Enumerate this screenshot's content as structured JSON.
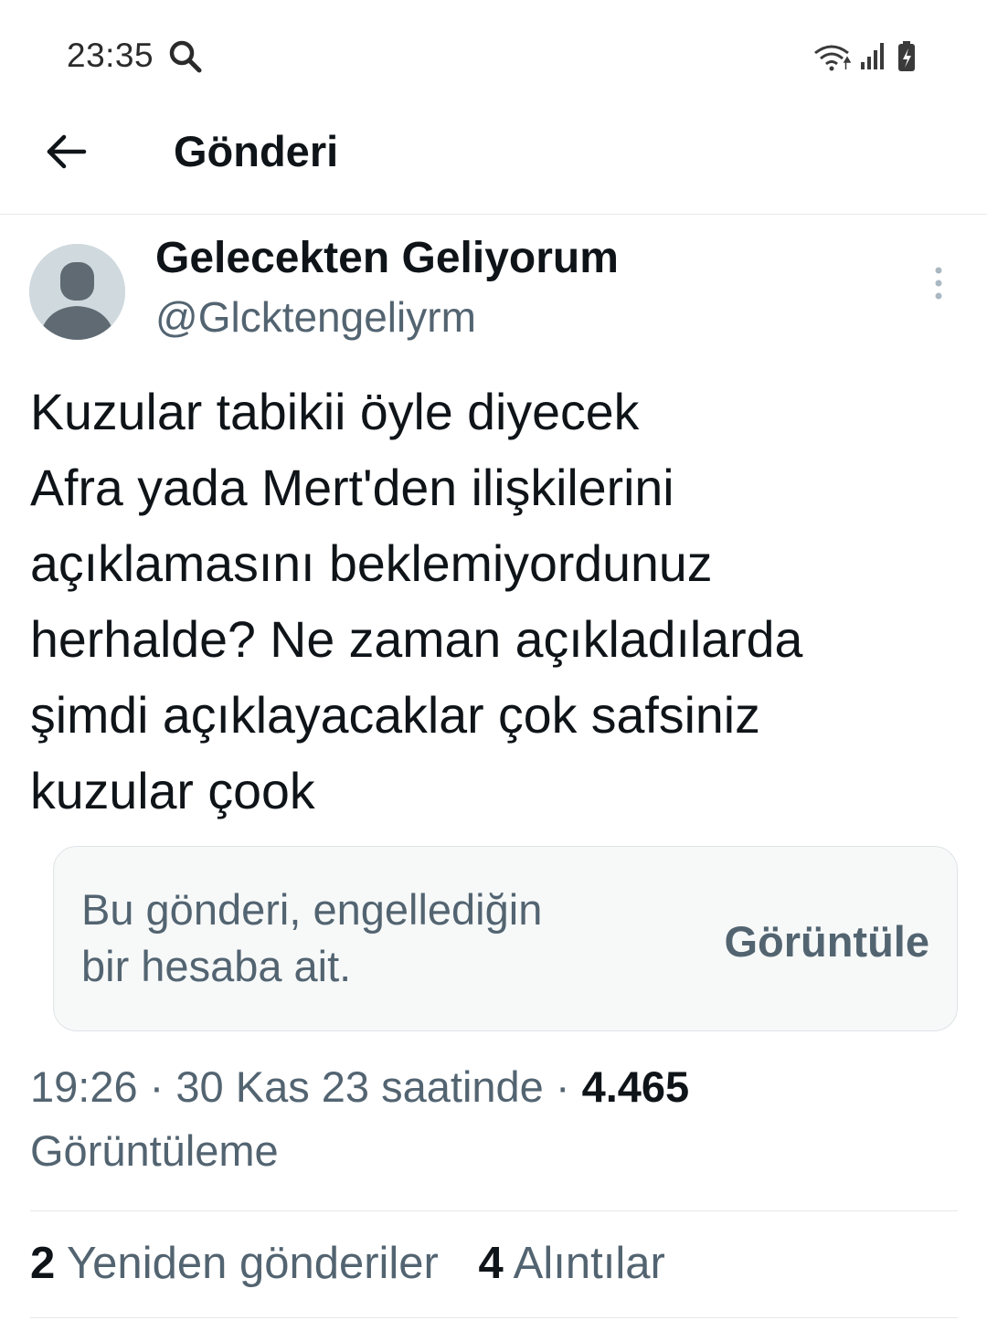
{
  "status_bar": {
    "time": "23:35",
    "icons": [
      "search-icon",
      "wifi-icon",
      "signal-icon",
      "battery-charging-icon"
    ]
  },
  "header": {
    "back_icon": "arrow-left-icon",
    "title": "Gönderi"
  },
  "tweet": {
    "author": {
      "name": "Gelecekten Geliyorum",
      "handle": "@Glcktengeliyrm",
      "avatar": "default-avatar-icon"
    },
    "more_icon": "more-vertical-icon",
    "text_lines": [
      "Kuzular tabikii öyle diyecek",
      "Afra yada Mert'den ilişkilerini",
      "açıklamasını beklemiyordunuz",
      "herhalde? Ne zaman açıkladılarda",
      "şimdi açıklayacaklar çok safsiniz",
      "kuzular çook"
    ],
    "quoted_blocked": {
      "message_lines": [
        "Bu gönderi, engellediğin",
        "bir hesaba ait."
      ],
      "action": "Görüntüle"
    },
    "timestamp": "19:26 · 30 Kas 23 saatinde · ",
    "views_count": "4.465",
    "views_label": "Görüntüleme",
    "stats": {
      "reposts_count": "2",
      "reposts_label": "Yeniden gönderiler",
      "quotes_count": "4",
      "quotes_label": "Alıntılar"
    }
  },
  "colors": {
    "text_primary": "#0f1419",
    "text_secondary": "#536471",
    "card_bg": "#f7f9f9",
    "divider": "#e6e9eb"
  }
}
